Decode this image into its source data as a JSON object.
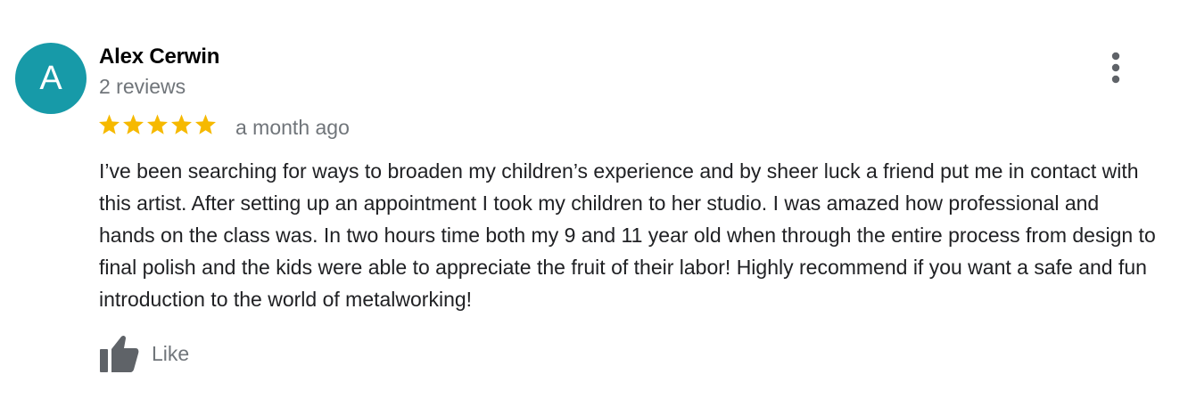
{
  "review": {
    "avatar_letter": "A",
    "avatar_color": "#179aa8",
    "author_name": "Alex Cerwin",
    "review_count": "2 reviews",
    "rating": 5,
    "rating_max": 5,
    "star_color": "#f6b900",
    "date": "a month ago",
    "text": "I’ve been searching for ways to broaden my children’s experience and by sheer luck a friend put me in contact with this artist. After setting up an appointment I took my children to her studio. I was amazed how professional and hands on the class was. In two hours time both my 9 and 11 year old when through the entire process from design to final polish and the kids were able to appreciate the fruit of their labor! Highly recommend if you want a safe and fun introduction to the world of metalworking!",
    "like_label": "Like",
    "more_icon": "more-vertical-icon",
    "like_icon": "thumbs-up-icon"
  }
}
